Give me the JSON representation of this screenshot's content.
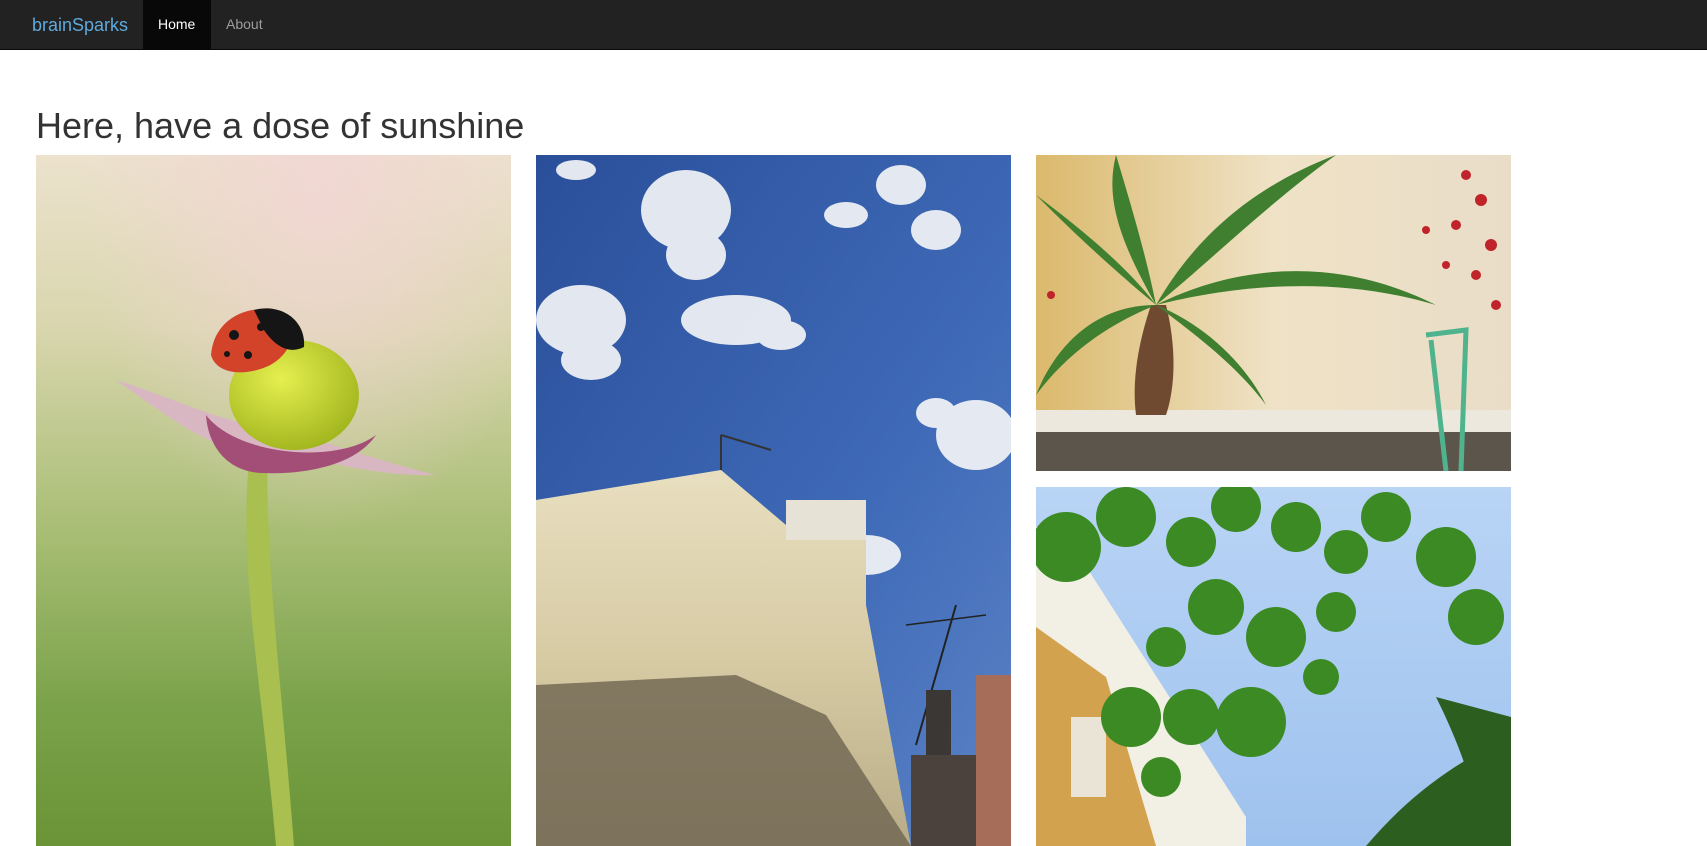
{
  "navbar": {
    "brand": "brainSparks",
    "items": [
      {
        "label": "Home",
        "active": true
      },
      {
        "label": "About",
        "active": false
      }
    ]
  },
  "main": {
    "heading": "Here, have a dose of sunshine"
  },
  "colors": {
    "navbar_bg": "#222222",
    "brand": "#5fa9dd",
    "active_bg": "#080808"
  },
  "gallery": [
    {
      "name": "ladybug-on-flower"
    },
    {
      "name": "building-and-blue-sky"
    },
    {
      "name": "palm-tree-on-terrace"
    },
    {
      "name": "leaves-and-sky"
    }
  ]
}
